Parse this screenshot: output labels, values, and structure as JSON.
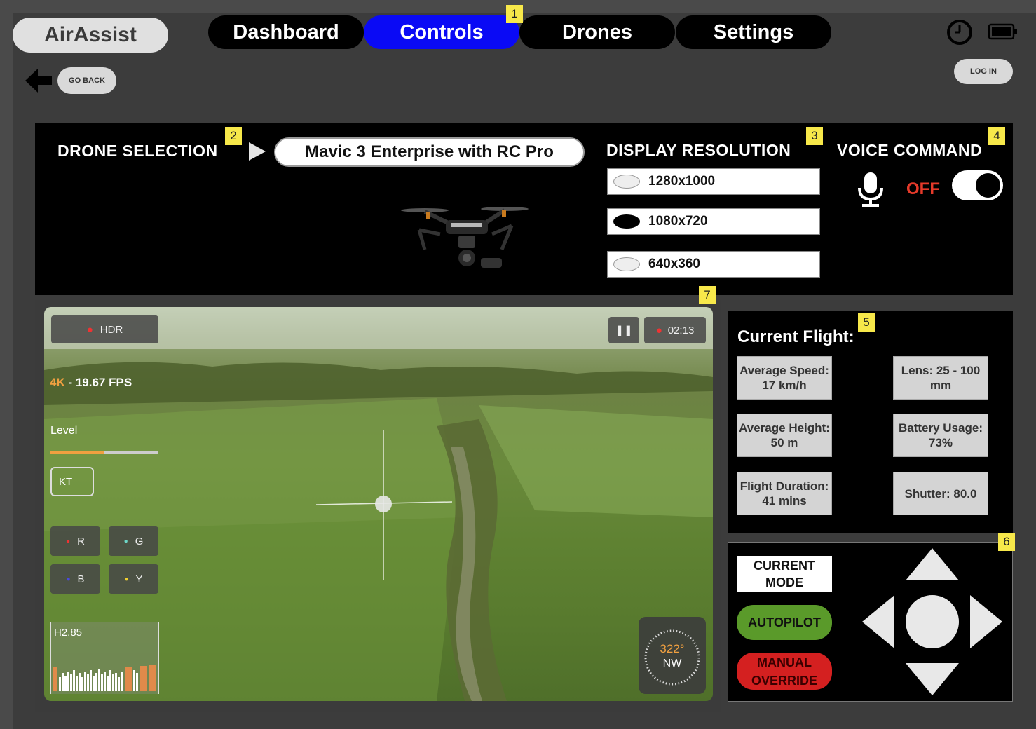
{
  "app": {
    "brand": "AirAssist"
  },
  "nav": {
    "tabs": [
      {
        "label": "Dashboard"
      },
      {
        "label": "Controls"
      },
      {
        "label": "Drones"
      },
      {
        "label": "Settings"
      }
    ],
    "active_tab": "Controls",
    "go_back_label": "GO BACK",
    "login_label": "LOG IN"
  },
  "badges": [
    "1",
    "2",
    "3",
    "4",
    "5",
    "6",
    "7"
  ],
  "drone_selection": {
    "label": "DRONE SELECTION",
    "selected_drone": "Mavic 3 Enterprise with RC Pro"
  },
  "display_resolution": {
    "label": "DISPLAY RESOLUTION",
    "options": [
      "1280x1000",
      "1080x720",
      "640x360"
    ],
    "selected": "1080x720"
  },
  "voice_command": {
    "label": "VOICE COMMAND",
    "state_text": "OFF",
    "enabled": false
  },
  "video": {
    "hdr_label": "HDR",
    "rec_time": "02:13",
    "quality_prefix": "4K",
    "quality_text": " - 19.67 FPS",
    "level_label": "Level",
    "kt_label": "KT",
    "channels": [
      "R",
      "G",
      "B",
      "Y"
    ],
    "histogram_label": "H2.85",
    "heading_degrees": "322°",
    "heading_dir": "NW"
  },
  "current_flight": {
    "title": "Current Flight:",
    "stats": {
      "avg_speed": "Average Speed: 17 km/h",
      "lens": "Lens: 25 - 100 mm",
      "avg_height": "Average Height: 50 m",
      "battery": "Battery Usage: 73%",
      "duration": "Flight Duration: 41 mins",
      "shutter": "Shutter: 80.0"
    }
  },
  "controls": {
    "current_mode_label": "CURRENT MODE",
    "autopilot_label": "AUTOPILOT",
    "manual_label": "MANUAL OVERRIDE"
  },
  "colors": {
    "active_tab": "#0a0af5",
    "autopilot": "#5a9a2a",
    "manual": "#d42020",
    "off_text": "#e53a2a",
    "badge": "#f7e84a"
  }
}
